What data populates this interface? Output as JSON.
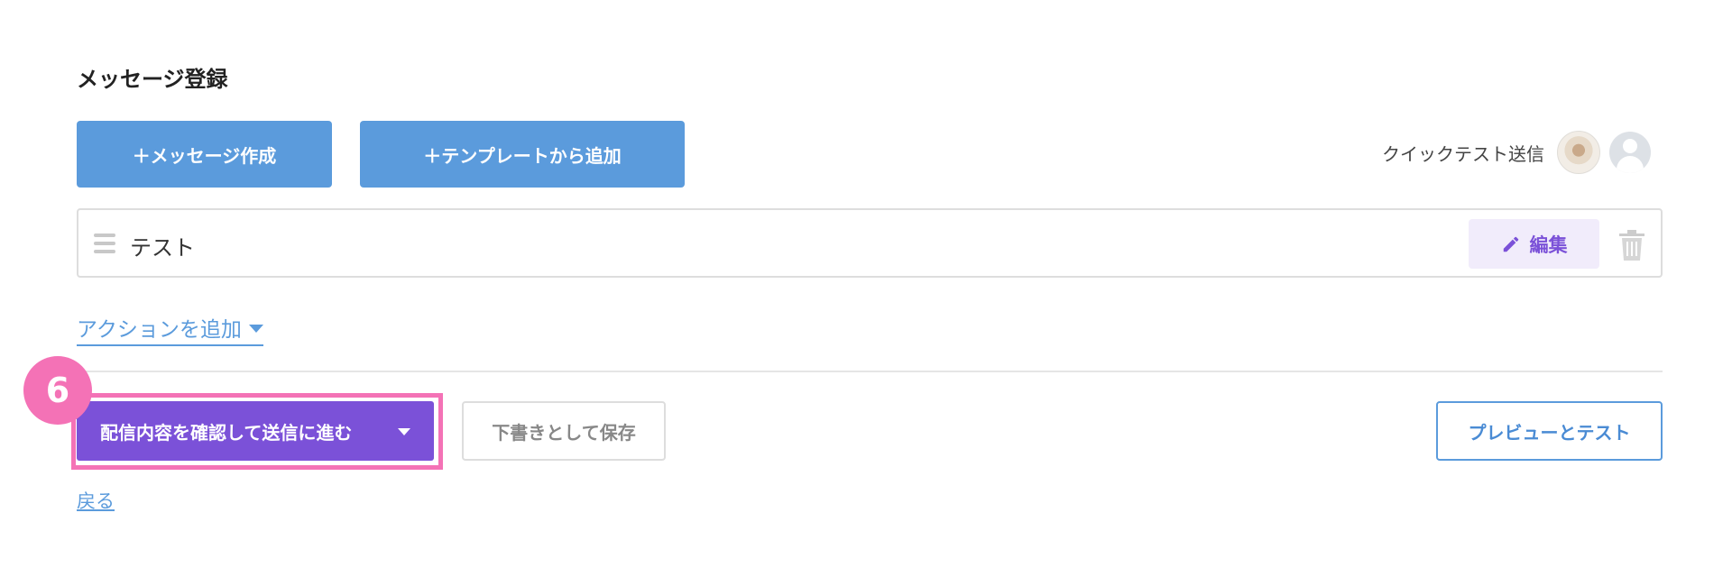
{
  "section": {
    "title": "メッセージ登録"
  },
  "toolbar": {
    "create_message_label": "＋メッセージ作成",
    "add_from_template_label": "＋テンプレートから追加"
  },
  "quick_test": {
    "label": "クイックテスト送信"
  },
  "messages": [
    {
      "name": "テスト",
      "edit_label": "編集"
    }
  ],
  "add_action": {
    "label": "アクションを追加"
  },
  "step_badge": "6",
  "footer": {
    "confirm_label": "配信内容を確認して送信に進む",
    "draft_label": "下書きとして保存",
    "preview_label": "プレビューとテスト",
    "back_label": "戻る"
  },
  "colors": {
    "primary_blue": "#5b9bdc",
    "primary_purple": "#7b51d8",
    "highlight_pink": "#f472b6",
    "edit_bg": "#f1ecfb"
  },
  "icons": {
    "drag": "drag-handle-icon",
    "edit": "pencil-icon",
    "delete": "trash-icon",
    "dropdown": "caret-down-icon"
  }
}
